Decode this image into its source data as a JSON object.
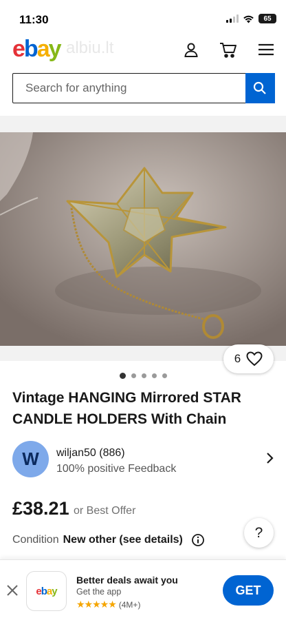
{
  "status_bar": {
    "time": "11:30",
    "battery": "65"
  },
  "header": {
    "logo": {
      "e": "e",
      "b": "b",
      "a": "a",
      "y": "y"
    },
    "watermark": "albiu.lt",
    "icons": [
      "account-icon",
      "cart-icon",
      "menu-icon"
    ]
  },
  "search": {
    "placeholder": "Search for anything"
  },
  "product": {
    "watch_count": "6",
    "image_count": 5,
    "active_image": 1,
    "title": "Vintage HANGING Mirrored STAR CANDLE HOLDERS With Chain",
    "price": "£38.21",
    "offer_text": "or Best Offer",
    "condition_label": "Condition",
    "condition_value": "New other (see details)"
  },
  "seller": {
    "avatar_letter": "W",
    "name": "wiljan50 (886)",
    "feedback": "100% positive Feedback"
  },
  "help": {
    "label": "?"
  },
  "app_banner": {
    "icon_text": {
      "e": "e",
      "b": "b",
      "a": "a",
      "y": "y"
    },
    "title": "Better deals await you",
    "subtitle": "Get the app",
    "stars": "★★★★★",
    "rating_count": "(4M+)",
    "cta": "GET"
  },
  "colors": {
    "ebay_red": "#e53238",
    "ebay_blue": "#0064d2",
    "ebay_yellow": "#f5af02",
    "ebay_green": "#86b817",
    "primary_button": "#0064d2"
  }
}
